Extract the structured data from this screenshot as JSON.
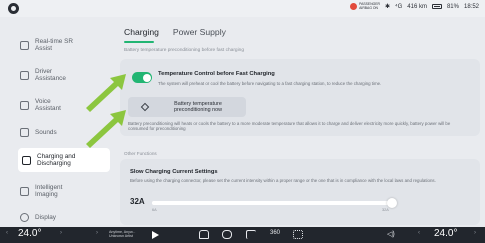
{
  "status": {
    "airbag": "PASSENGER\nAIRBAG ON",
    "bluetooth": "✱",
    "signal": "⁴G",
    "range": "416 km",
    "battery": "81%",
    "time": "18:52"
  },
  "sidebar": {
    "items": [
      {
        "label": "Real-time SR\nAssist",
        "icon": "sr-assist-icon"
      },
      {
        "label": "Driver\nAssistance",
        "icon": "driver-assistance-icon"
      },
      {
        "label": "Voice\nAssistant",
        "icon": "voice-assistant-icon"
      },
      {
        "label": "Sounds",
        "icon": "speaker-icon"
      },
      {
        "label": "Charging and\nDischarging",
        "icon": "charging-icon"
      },
      {
        "label": "Intelligent\nImaging",
        "icon": "imaging-icon"
      },
      {
        "label": "Display",
        "icon": "display-icon"
      }
    ]
  },
  "main": {
    "tabs": [
      {
        "label": "Charging"
      },
      {
        "label": "Power Supply"
      }
    ],
    "note": "Battery temperature preconditioning before fast charging",
    "temp_control": {
      "title": "Temperature Control before Fast Charging",
      "desc": "The system will preheat or cool the battery before navigating to a fast charging station, to reduce the charging time.",
      "enabled": true
    },
    "precond_button": "Battery temperature\npreconditioning now",
    "precond_desc": "Battery preconditioning will heats or cools the battery to a more moderate temperature that allows it to charge and deliver electricity more quickly, battery power will be consumed for preconditioning",
    "other_label": "Other Functions",
    "slow_charge": {
      "title": "Slow Charging Current Settings",
      "desc": "Before using the charging connector, please set the current intensity within a proper range or the one that is in compliance with the local laws and regulations.",
      "value": "32A",
      "min_label": "6A",
      "max_label": "32A",
      "level": 1.0
    }
  },
  "dock": {
    "temp_left": "24.0°",
    "temp_right": "24.0°",
    "media": "Anytime, Anyw...\nUnknown Artist",
    "icons": [
      "home-icon",
      "car-icon",
      "music-icon",
      "360-view-icon",
      "apps-icon"
    ],
    "view360": "360",
    "volume": "◁)"
  },
  "colors": {
    "accent": "#22b573",
    "arrow": "#8cc63f"
  }
}
